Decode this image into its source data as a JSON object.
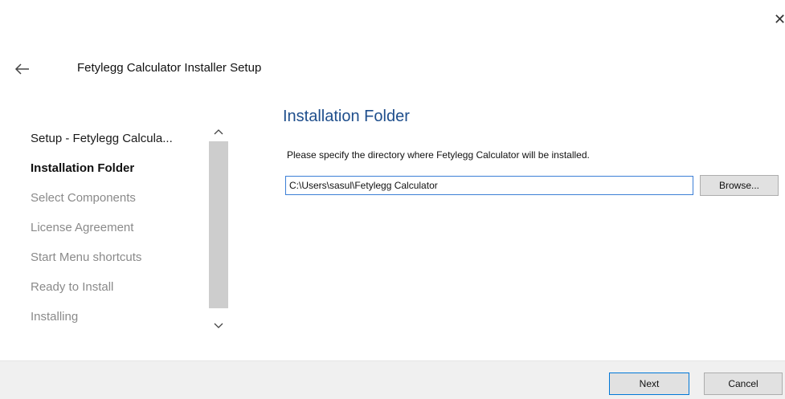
{
  "window": {
    "close_glyph": "✕",
    "title": "Fetylegg Calculator Installer Setup"
  },
  "sidebar": {
    "items": [
      {
        "label": "Setup - Fetylegg Calcula..."
      },
      {
        "label": "Installation Folder"
      },
      {
        "label": "Select Components"
      },
      {
        "label": "License Agreement"
      },
      {
        "label": "Start Menu shortcuts"
      },
      {
        "label": "Ready to Install"
      },
      {
        "label": "Installing"
      }
    ],
    "active_index": 1,
    "scroll_up_glyph": "^",
    "scroll_down_glyph": "v"
  },
  "main": {
    "heading": "Installation Folder",
    "instruction": "Please specify the directory where Fetylegg Calculator will be installed.",
    "path_value": "C:\\Users\\sasul\\Fetylegg Calculator",
    "browse_label": "Browse..."
  },
  "footer": {
    "next_label": "Next",
    "cancel_label": "Cancel"
  },
  "colors": {
    "heading": "#1e4e8c",
    "input_focus_border": "#3c7fd6",
    "default_button_border": "#0078d7",
    "inactive_step_text": "#8a8a8a",
    "footer_bg": "#f0f0f0"
  },
  "icons": {
    "back": "back-arrow-icon",
    "close": "close-icon",
    "scroll_up": "chevron-up-icon",
    "scroll_down": "chevron-down-icon"
  }
}
